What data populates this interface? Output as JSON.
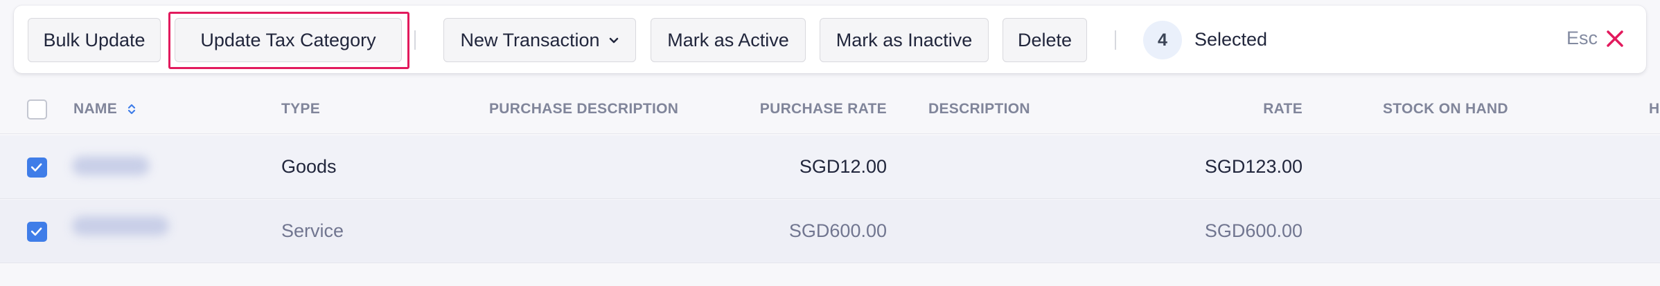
{
  "toolbar": {
    "bulk_update_label": "Bulk Update",
    "update_tax_category_label": "Update Tax Category",
    "new_transaction_label": "New Transaction",
    "mark_active_label": "Mark as Active",
    "mark_inactive_label": "Mark as Inactive",
    "delete_label": "Delete",
    "selected_count": "4",
    "selected_label": "Selected",
    "esc_label": "Esc",
    "highlight_color": "#e21a5d"
  },
  "table": {
    "columns": {
      "name": "NAME",
      "type": "TYPE",
      "purchase_description": "PURCHASE DESCRIPTION",
      "purchase_rate": "PURCHASE RATE",
      "description": "DESCRIPTION",
      "rate": "RATE",
      "stock_on_hand": "STOCK ON HAND",
      "overflow": "H"
    },
    "rows": [
      {
        "type": "Goods",
        "purchase_rate": "SGD12.00",
        "rate": "SGD123.00",
        "checked": true
      },
      {
        "type": "Service",
        "purchase_rate": "SGD600.00",
        "rate": "SGD600.00",
        "checked": true
      }
    ]
  },
  "colors": {
    "accent_blue": "#3f7de8",
    "close_icon": "#e21a5d"
  }
}
